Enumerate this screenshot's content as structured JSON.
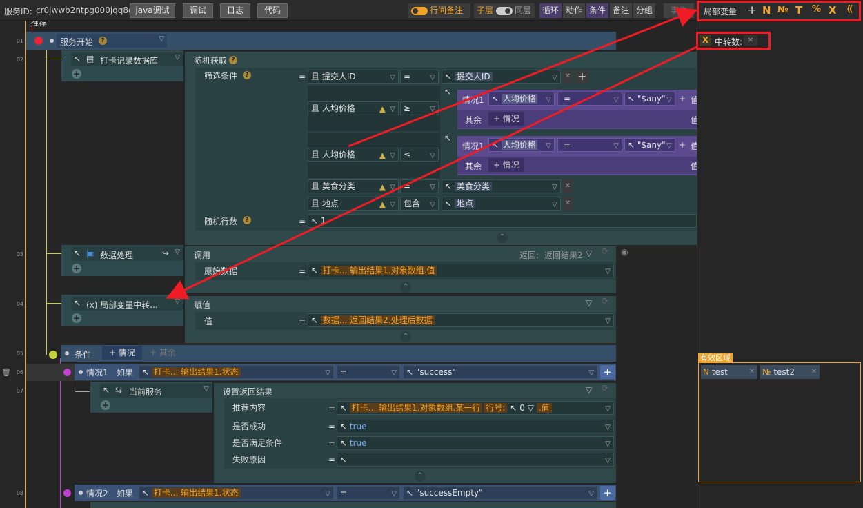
{
  "topbar": {
    "service_label": "服务ID:",
    "service_id": "cr0jwwb2ntpg000jqq8g",
    "buttons": [
      "java调试",
      "调试",
      "日志",
      "代码"
    ],
    "toggle_comment": "行间备注",
    "toggle_sub": "子层",
    "toggle_same": "同层",
    "chips": [
      "循环",
      "动作",
      "条件",
      "备注",
      "分组"
    ],
    "event": "事件"
  },
  "line_numbers": [
    "01",
    "02",
    "03",
    "04",
    "05",
    "06",
    "07",
    "08"
  ],
  "nodes": {
    "partial_top": "推荐",
    "service_start": "服务开始",
    "db_node": "打卡记录数据库",
    "random_get": "随机获取",
    "filter_label": "筛选条件",
    "filters": [
      {
        "conj": "且",
        "field": "提交人ID",
        "op": "=",
        "value": "提交人ID"
      },
      {
        "conj": "且",
        "field": "人均价格",
        "op": "≥"
      },
      {
        "conj": "且",
        "field": "人均价格",
        "op": "≤"
      },
      {
        "conj": "且",
        "field": "美食分类",
        "op": "=",
        "value": "美食分类"
      },
      {
        "conj": "且",
        "field": "地点",
        "op": "包含",
        "value": "地点"
      }
    ],
    "case_label": "情况1",
    "case_field": "人均价格",
    "case_op": "=",
    "case_value": "\"$any\"",
    "else_label": "其余",
    "add_case": "+ 情况",
    "value_short": "值",
    "random_rows": "随机行数",
    "random_rows_value": "1",
    "data_proc": "数据处理",
    "call": "调用",
    "return_label": "返回:",
    "return_value": "返回结果2",
    "raw_data": "原始数据",
    "raw_data_value": "打卡... 输出结果1.对象数组.值",
    "local_var": "(x) 局部变量中转...",
    "assign": "赋值",
    "value": "值",
    "value_expr": "数据... 返回结果2.处理后数据",
    "cond": "条件",
    "cond_case": "+ 情况",
    "cond_else": "+ 其余",
    "case1": "情况1",
    "if_label": "如果",
    "case1_field": "打卡... 输出结果1.状态",
    "case1_op": "=",
    "case1_value": "\"success\"",
    "cur_service": "当前服务",
    "set_return": "设置返回结果",
    "ret_fields": [
      {
        "label": "推荐内容",
        "value": "打卡... 输出结果1.对象数组.某一行",
        "row_label": "行号:",
        "row_value": "0",
        "suffix": ".值"
      },
      {
        "label": "是否成功",
        "value": "true"
      },
      {
        "label": "是否满足条件",
        "value": "true"
      },
      {
        "label": "失败原因",
        "value": ""
      }
    ],
    "case2": "情况2",
    "case2_field": "打卡... 输出结果1.状态",
    "case2_op": "=",
    "case2_value": "\"successEmpty\""
  },
  "right_panel": {
    "title": "局部变量",
    "type_icons": [
      "N",
      "№",
      "T",
      "%",
      "X",
      "⟪"
    ],
    "var_name": "中转数:",
    "scope_title": "有效区域",
    "scope_vars": [
      {
        "type": "N",
        "name": "test"
      },
      {
        "type": "№",
        "name": "test2"
      }
    ]
  },
  "colors": {
    "accent": "#f0a52a",
    "annotation": "#ee1c24",
    "purple": "#5b4a8e",
    "panel_bg": "#304a4c"
  }
}
